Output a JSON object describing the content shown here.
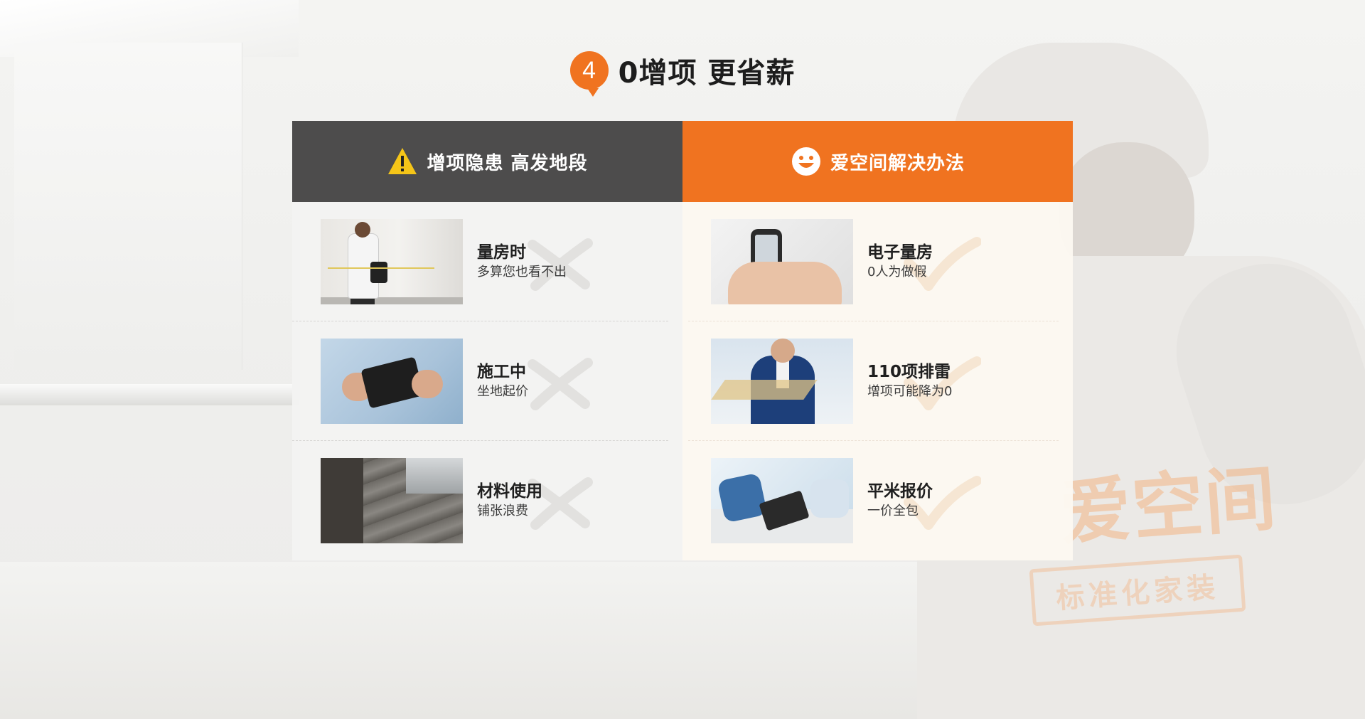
{
  "section": {
    "number": "4",
    "title": "0增项 更省薪"
  },
  "left_column": {
    "header": "增项隐患  高发地段",
    "header_icon": "warning-icon",
    "rows": [
      {
        "title": "量房时",
        "subtitle": "多算您也看不出",
        "image": "measuring-wall-photo"
      },
      {
        "title": "施工中",
        "subtitle": "坐地起价",
        "image": "wallet-photo"
      },
      {
        "title": "材料使用",
        "subtitle": "铺张浪费",
        "image": "floor-materials-photo"
      }
    ]
  },
  "right_column": {
    "header": "爱空间解决办法",
    "header_icon": "smiley-icon",
    "rows": [
      {
        "title": "电子量房",
        "subtitle": "0人为做假",
        "image": "laser-meter-photo"
      },
      {
        "title": "110项排雷",
        "subtitle": "增项可能降为0",
        "image": "floorplan-presentation-photo"
      },
      {
        "title": "平米报价",
        "subtitle": "一价全包",
        "image": "tablet-meeting-photo"
      }
    ]
  },
  "background": {
    "logo_text": "爱空间",
    "logo_subtext": "标准化家装"
  },
  "colors": {
    "accent": "#f07320",
    "dark_header": "#4d4c4c",
    "warning": "#f5c518"
  }
}
